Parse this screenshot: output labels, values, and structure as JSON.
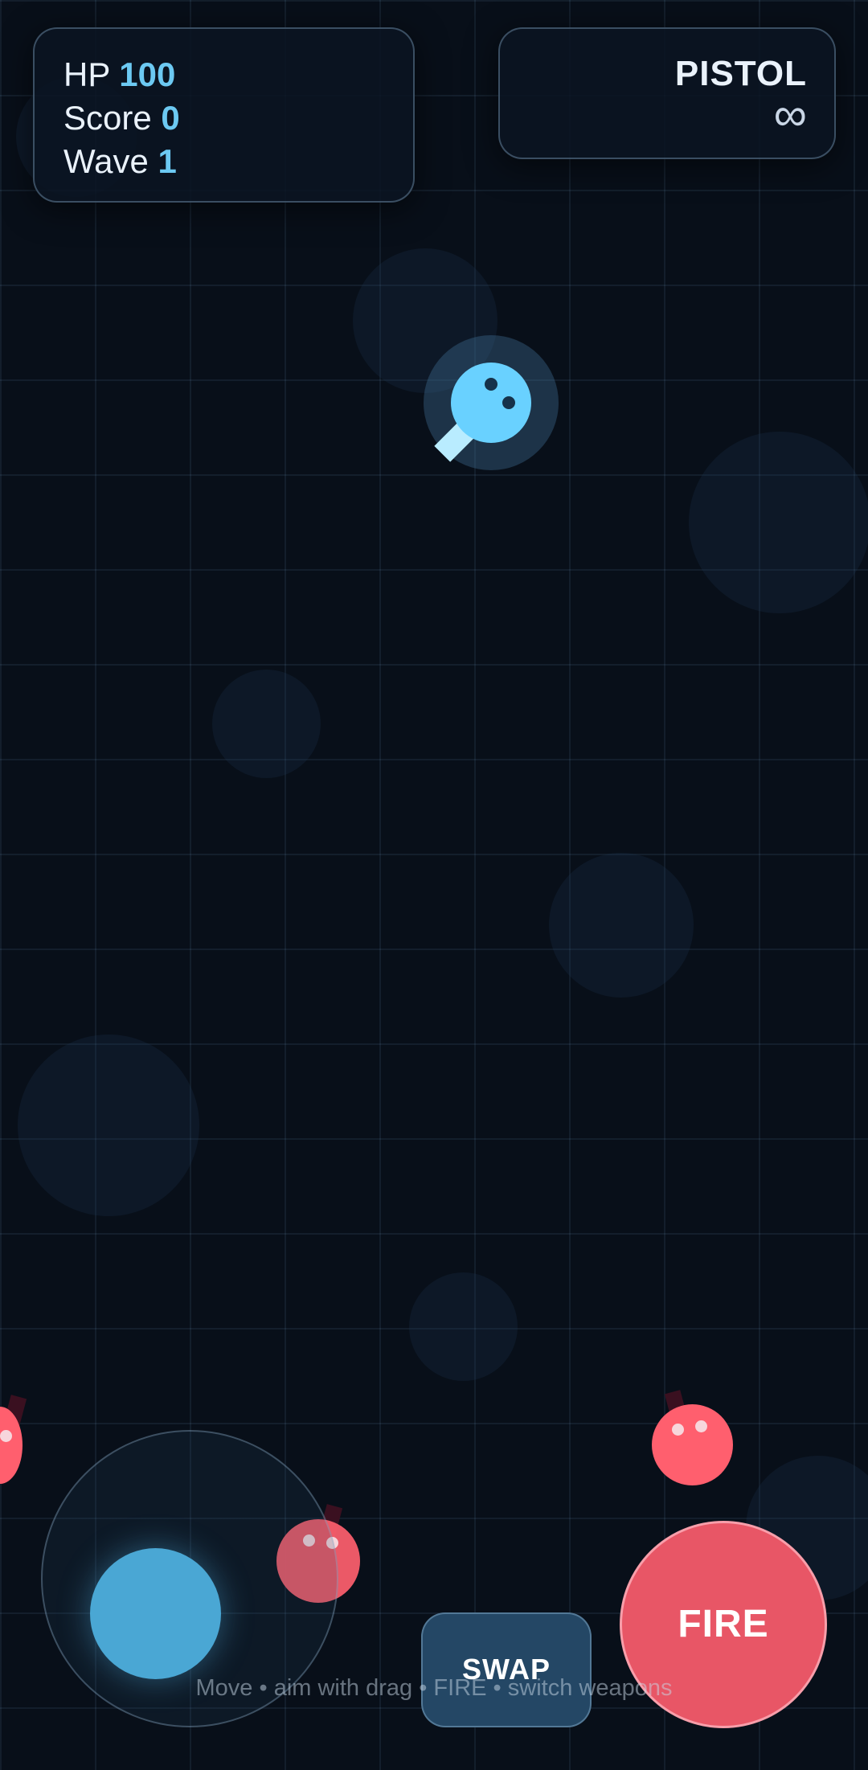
{
  "hud": {
    "hp_label": "HP",
    "hp_value": "100",
    "score_label": "Score",
    "score_value": "0",
    "wave_label": "Wave",
    "wave_value": "1"
  },
  "weapon": {
    "name": "PISTOL",
    "ammo": "∞"
  },
  "controls": {
    "swap_label": "SWAP",
    "fire_label": "FIRE",
    "hint": "Move • aim with drag • FIRE • switch weapons"
  },
  "colors": {
    "background": "#080f19",
    "accent": "#6cc9f2",
    "player": "#69d1ff",
    "enemy": "#ff5f6e",
    "fire_button": "#e85666",
    "swap_button": "#244765"
  },
  "icons": {
    "player": "player-character",
    "enemy": "enemy-character",
    "joystick": "virtual-joystick"
  }
}
